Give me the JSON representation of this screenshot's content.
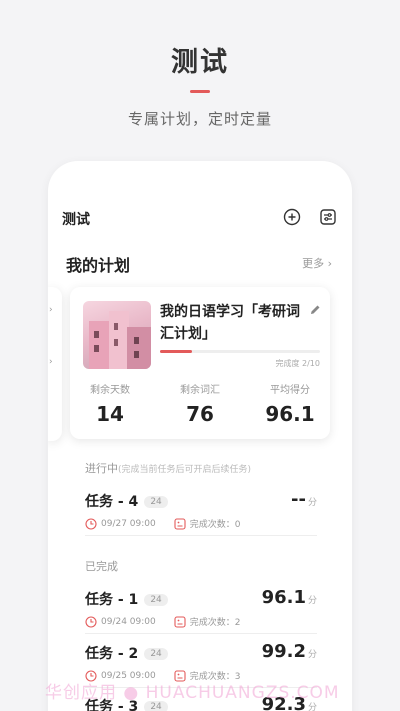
{
  "hero": {
    "title": "测试",
    "subtitle": "专属计划，定时定量"
  },
  "app": {
    "title": "测试"
  },
  "plans": {
    "section_title": "我的计划",
    "more_label": "更多",
    "card": {
      "title": "我的日语学习「考研词汇计划」",
      "progress_label": "完成度 2/10",
      "progress": 0.2,
      "stats": [
        {
          "label": "剩余天数",
          "value": "14"
        },
        {
          "label": "剩余词汇",
          "value": "76"
        },
        {
          "label": "平均得分",
          "value": "96.1"
        }
      ]
    }
  },
  "in_progress": {
    "title": "进行中",
    "hint": "(完成当前任务后可开启后续任务)",
    "tasks": [
      {
        "name": "任务 - 4",
        "badge": "24",
        "score": "--",
        "unit": "分",
        "date": "09/27 09:00",
        "count": "完成次数：0"
      }
    ]
  },
  "completed": {
    "title": "已完成",
    "tasks": [
      {
        "name": "任务 - 1",
        "badge": "24",
        "score": "96.1",
        "unit": "分",
        "date": "09/24 09:00",
        "count": "完成次数：2"
      },
      {
        "name": "任务 - 2",
        "badge": "24",
        "score": "99.2",
        "unit": "分",
        "date": "09/25 09:00",
        "count": "完成次数：3"
      },
      {
        "name": "任务 - 3",
        "badge": "24",
        "score": "92.3",
        "unit": "分"
      }
    ]
  },
  "watermark": "华创应用 ● HUACHUANGZS.COM",
  "colors": {
    "accent": "#e35a5a",
    "background": "#f4f4f6"
  }
}
